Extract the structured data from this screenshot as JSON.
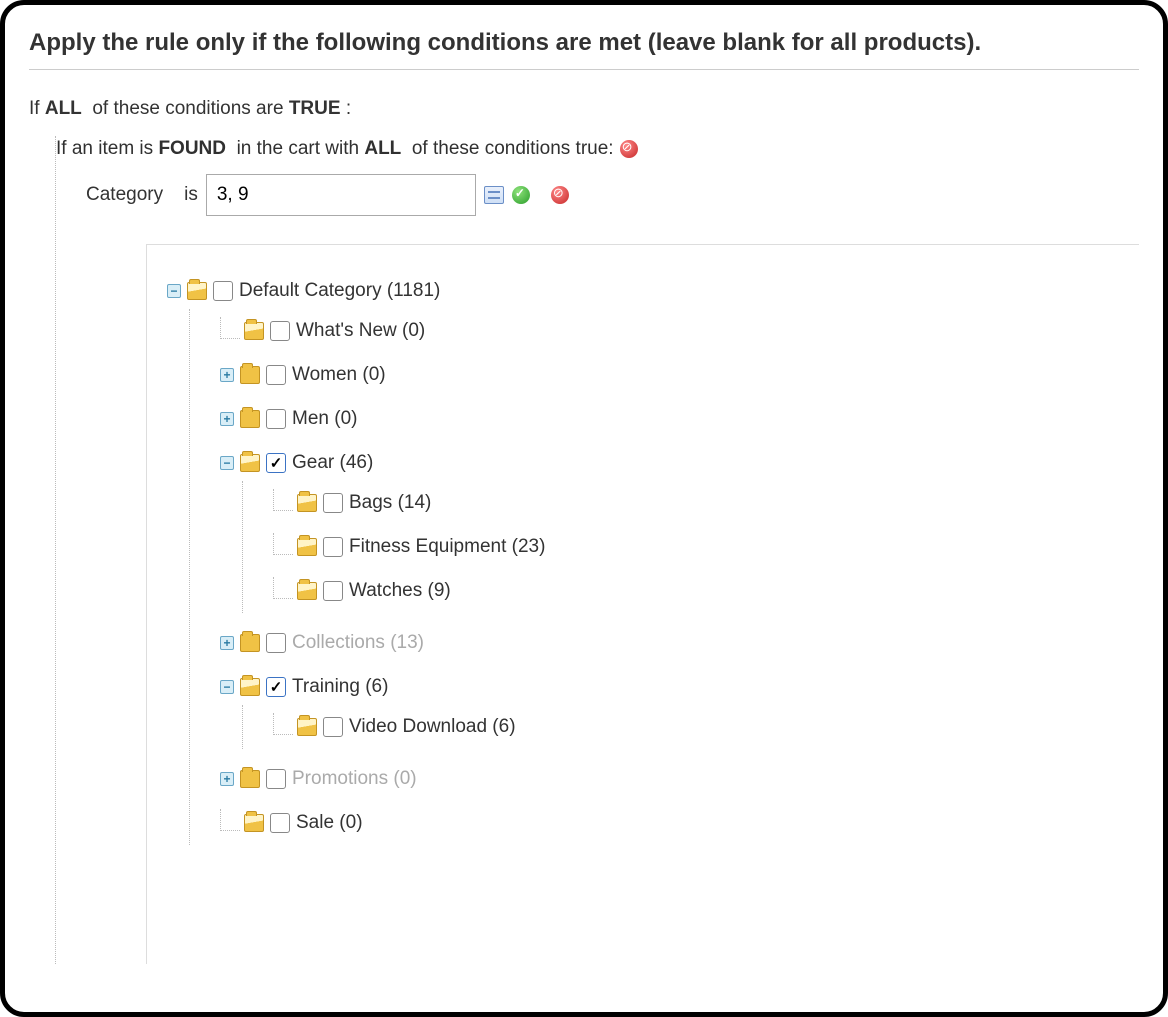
{
  "section_title": "Apply the rule only if the following conditions are met (leave blank for all products).",
  "root_condition": {
    "prefix": "If",
    "aggregator": "ALL",
    "middle": "of these conditions are",
    "value": "TRUE",
    "suffix": ":"
  },
  "cart_condition": {
    "prefix": "If an item is",
    "found": "FOUND",
    "middle": "in the cart with",
    "aggregator": "ALL",
    "suffix": "of these conditions true:"
  },
  "attr_condition": {
    "attribute": "Category",
    "operator": "is",
    "value": "3, 9"
  },
  "tree": [
    {
      "label": "Default Category (1181)",
      "expanded": true,
      "checked": false,
      "open": true,
      "children": [
        {
          "label": "What's New (0)",
          "leaf": true,
          "checked": false
        },
        {
          "label": "Women (0)",
          "expanded": false,
          "checked": false
        },
        {
          "label": "Men (0)",
          "expanded": false,
          "checked": false
        },
        {
          "label": "Gear (46)",
          "expanded": true,
          "checked": true,
          "open": true,
          "children": [
            {
              "label": "Bags (14)",
              "leaf": true,
              "checked": false
            },
            {
              "label": "Fitness Equipment (23)",
              "leaf": true,
              "checked": false
            },
            {
              "label": "Watches (9)",
              "leaf": true,
              "checked": false
            }
          ]
        },
        {
          "label": "Collections (13)",
          "expanded": false,
          "checked": false,
          "muted": true
        },
        {
          "label": "Training (6)",
          "expanded": true,
          "checked": true,
          "open": true,
          "children": [
            {
              "label": "Video Download (6)",
              "leaf": true,
              "checked": false
            }
          ]
        },
        {
          "label": "Promotions (0)",
          "expanded": false,
          "checked": false,
          "muted": true
        },
        {
          "label": "Sale (0)",
          "leaf": true,
          "checked": false
        }
      ]
    }
  ]
}
